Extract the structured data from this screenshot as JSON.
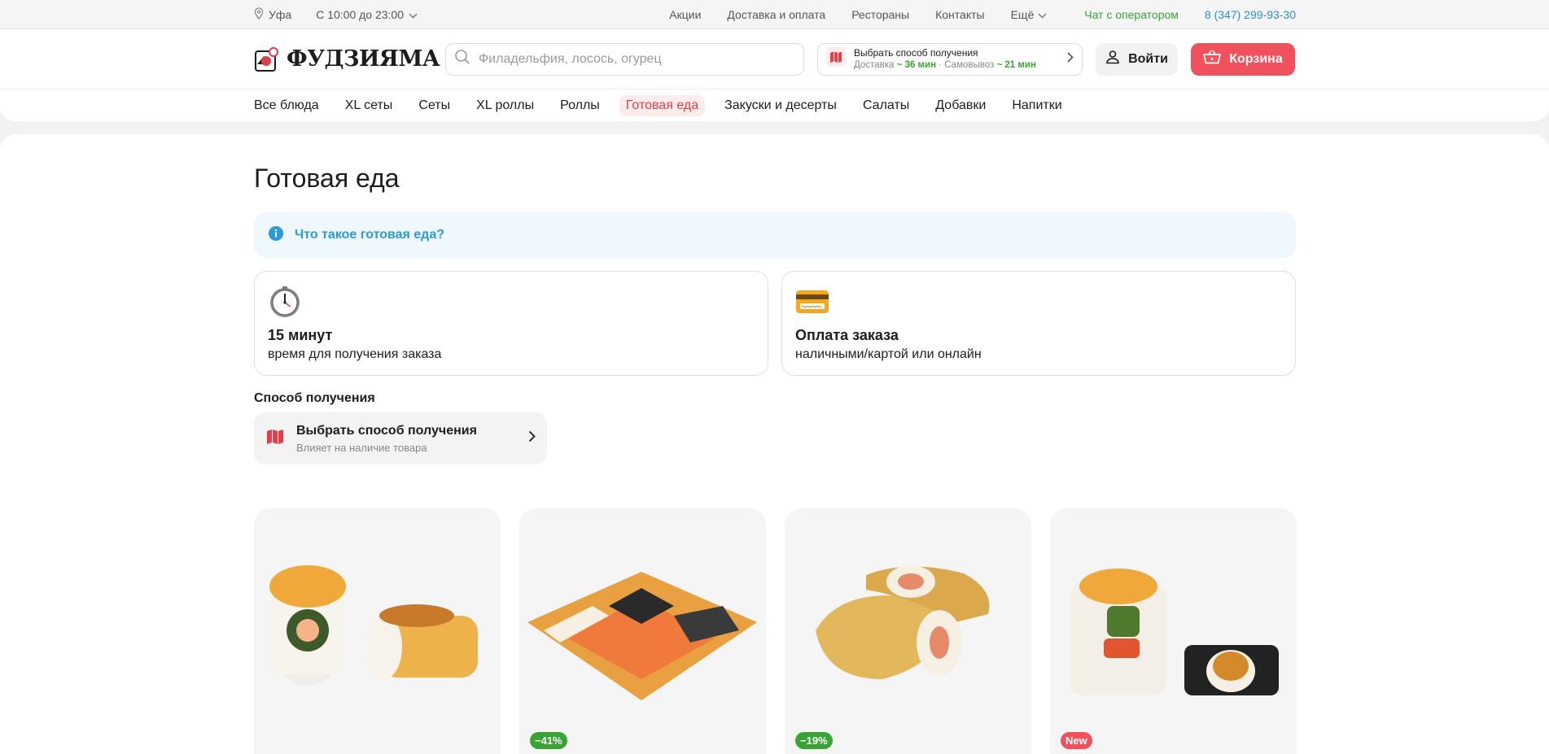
{
  "topbar": {
    "city": "Уфа",
    "hours": "С 10:00 до 23:00",
    "links": [
      "Акции",
      "Доставка и оплата",
      "Рестораны",
      "Контакты"
    ],
    "more": "Ещё",
    "chat": "Чат с оператором",
    "phone": "8 (347) 299-93-30"
  },
  "header": {
    "logo": "ФУДЗИЯМА",
    "search_placeholder": "Филадельфия, лосось, огурец",
    "receive_title": "Выбрать способ получения",
    "delivery_label": "Доставка",
    "delivery_time": "~ 36 мин",
    "pickup_label": "Самовывоз",
    "pickup_time": "~ 21 мин",
    "login": "Войти",
    "cart": "Корзина"
  },
  "nav": [
    "Все блюда",
    "XL сеты",
    "Сеты",
    "XL роллы",
    "Роллы",
    "Готовая еда",
    "Закуски и десерты",
    "Салаты",
    "Добавки",
    "Напитки"
  ],
  "nav_active": "Готовая еда",
  "main": {
    "title": "Готовая еда",
    "info": "Что такое готовая еда?",
    "cards": [
      {
        "title": "15 минут",
        "sub": "время для получения заказа"
      },
      {
        "title": "Оплата заказа",
        "sub": "наличными/картой или онлайн"
      }
    ],
    "method_label": "Способ получения",
    "method_title": "Выбрать способ получения",
    "method_sub": "Влияет на наличие товара",
    "products": [
      {
        "badge": ""
      },
      {
        "badge": "−41%"
      },
      {
        "badge": "−19%"
      },
      {
        "badge": "New"
      }
    ]
  },
  "colors": {
    "accent": "#f0515d",
    "green": "#3aa335",
    "blue": "#2b9ad8"
  }
}
